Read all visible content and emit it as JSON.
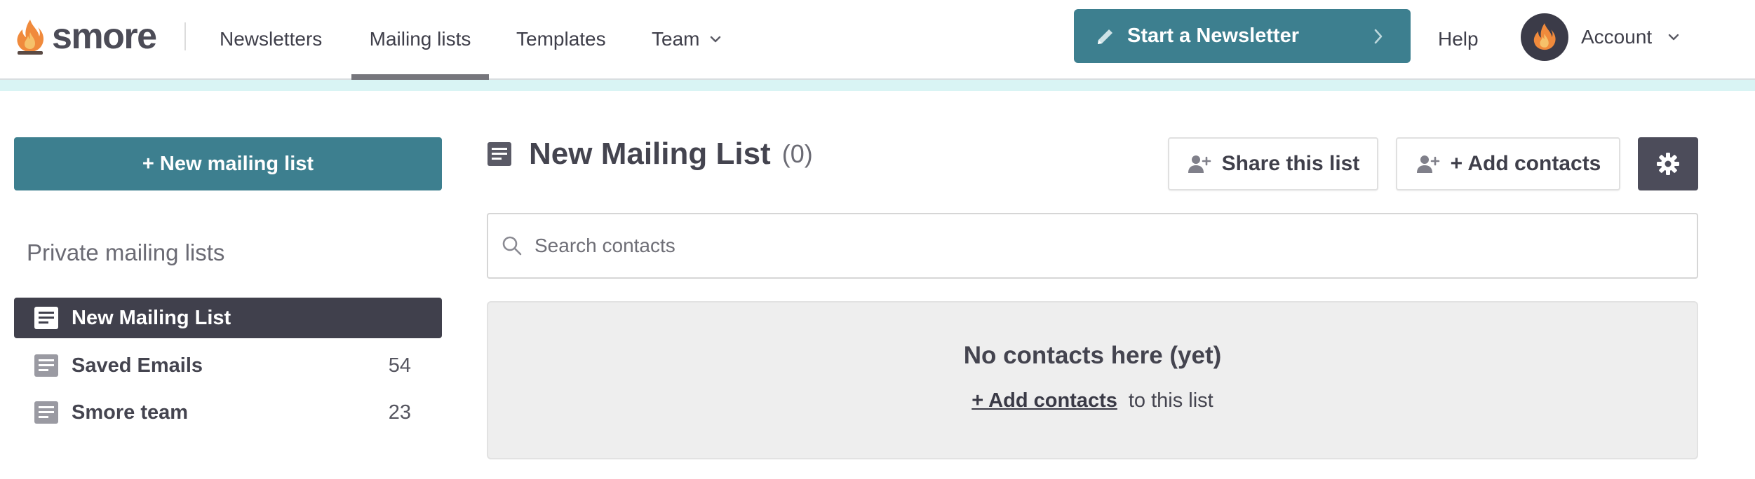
{
  "brand": {
    "name": "smore",
    "logo_icon": "flame-logo-icon"
  },
  "nav": {
    "newsletters": "Newsletters",
    "mailing_lists": "Mailing lists",
    "templates": "Templates",
    "team": "Team",
    "active": "Mailing lists"
  },
  "header": {
    "start_newsletter": "Start a Newsletter",
    "help": "Help",
    "account": "Account"
  },
  "sidebar": {
    "new_list_button": "+ New mailing list",
    "heading": "Private mailing lists",
    "items": [
      {
        "label": "New Mailing List",
        "count": "",
        "active": true
      },
      {
        "label": "Saved Emails",
        "count": "54",
        "active": false
      },
      {
        "label": "Smore team",
        "count": "23",
        "active": false
      }
    ]
  },
  "main": {
    "title": "New Mailing List",
    "count": "(0)",
    "share_button": "Share this list",
    "add_button": "+ Add contacts",
    "search_placeholder": "Search contacts",
    "empty_title": "No contacts here (yet)",
    "empty_link": "+ Add contacts",
    "empty_suffix": "to this list"
  },
  "colors": {
    "primary": "#3d7f8f",
    "dark": "#40404c",
    "accent_band": "#d9f4f4",
    "panel": "#eeeeee"
  }
}
